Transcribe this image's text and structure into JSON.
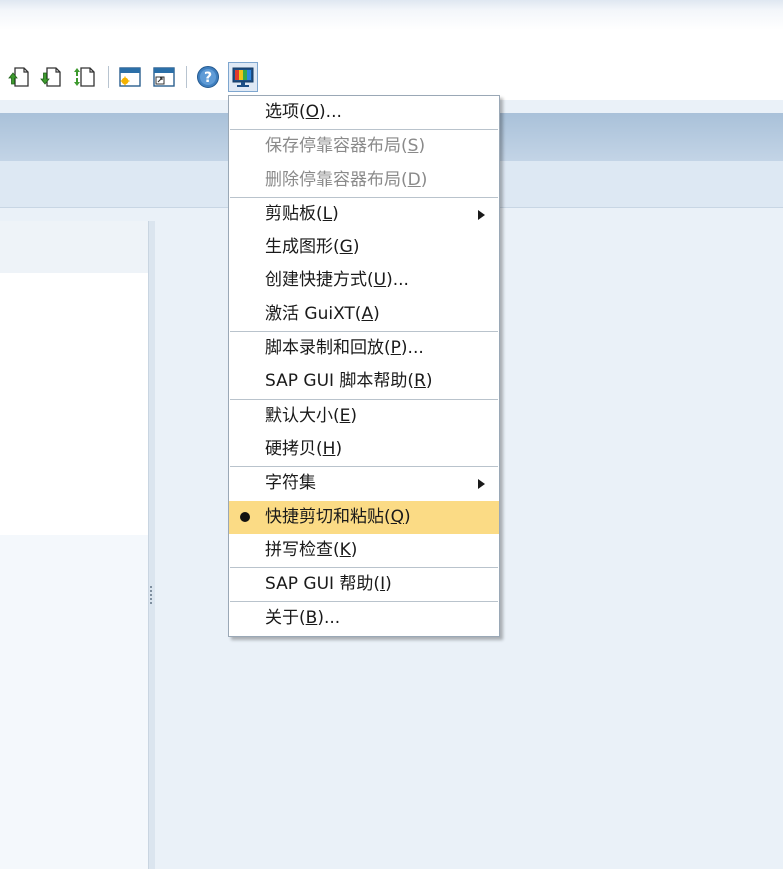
{
  "menu": {
    "items": [
      {
        "pre": "选项(",
        "key": "O",
        "post": ")..."
      },
      {
        "pre": "保存停靠容器布局(",
        "key": "S",
        "post": ")",
        "disabled": true
      },
      {
        "pre": "删除停靠容器布局(",
        "key": "D",
        "post": ")",
        "disabled": true
      },
      {
        "pre": "剪贴板(",
        "key": "L",
        "post": ")",
        "submenu": true
      },
      {
        "pre": "生成图形(",
        "key": "G",
        "post": ")"
      },
      {
        "pre": "创建快捷方式(",
        "key": "U",
        "post": ")..."
      },
      {
        "pre": "激活 GuiXT(",
        "key": "A",
        "post": ")"
      },
      {
        "pre": "脚本录制和回放(",
        "key": "P",
        "post": ")..."
      },
      {
        "pre": "SAP GUI 脚本帮助(",
        "key": "R",
        "post": ")"
      },
      {
        "pre": "默认大小(",
        "key": "E",
        "post": ")"
      },
      {
        "pre": "硬拷贝(",
        "key": "H",
        "post": ")"
      },
      {
        "pre": "字符集",
        "key": "",
        "post": "",
        "submenu": true
      },
      {
        "pre": "快捷剪切和粘贴(",
        "key": "Q",
        "post": ")",
        "checked": true,
        "highlighted": true
      },
      {
        "pre": "拼写检查(",
        "key": "K",
        "post": ")"
      },
      {
        "pre": "SAP GUI 帮助(",
        "key": "I",
        "post": ")"
      },
      {
        "pre": "关于(",
        "key": "B",
        "post": ")..."
      }
    ]
  },
  "toolbar": {
    "icons": [
      "upload-icon",
      "download-icon",
      "transfer-icon",
      "new-session-icon",
      "shortcut-icon",
      "help-icon",
      "customize-layout-icon"
    ]
  },
  "colors": {
    "highlight": "#fbdb85",
    "background": "#eaf1f8",
    "header_bar": "#b3c8de"
  }
}
